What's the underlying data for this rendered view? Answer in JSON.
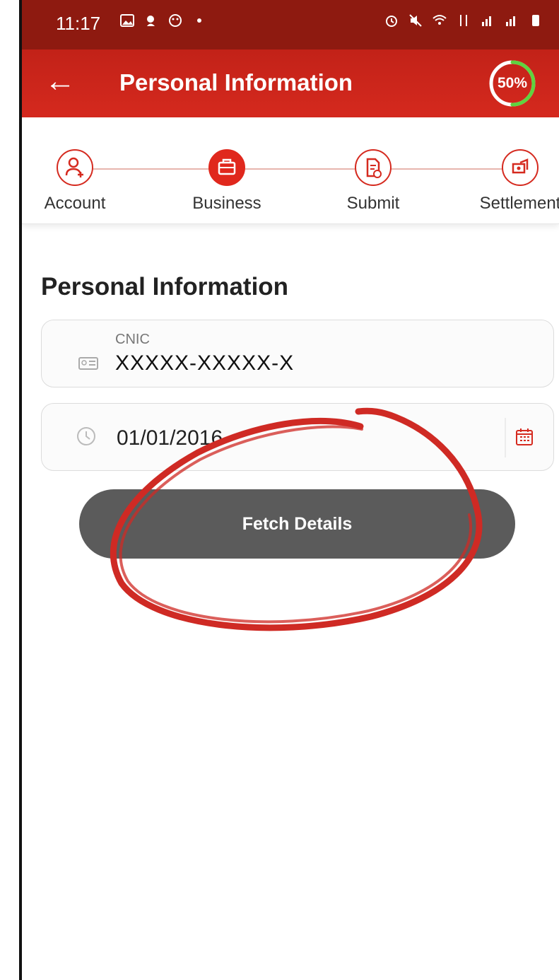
{
  "status_bar": {
    "time": "11:17"
  },
  "app_bar": {
    "title": "Personal Information",
    "back_icon": "arrow-left-icon",
    "progress_text": "50%",
    "progress": 0.5
  },
  "steps": [
    {
      "label": "Account",
      "icon": "user-add-icon"
    },
    {
      "label": "Business",
      "icon": "briefcase-icon",
      "active": true
    },
    {
      "label": "Submit",
      "icon": "document-icon"
    },
    {
      "label": "Settlement",
      "icon": "settlement-icon"
    }
  ],
  "form": {
    "section_title": "Personal Information",
    "cnic_label": "CNIC",
    "cnic_value": "XXXXX-XXXXX-X",
    "date_value": "01/01/2016",
    "fetch_label": "Fetch Details"
  },
  "colors": {
    "primary": "#d5291e",
    "status_bar": "#8e1a10",
    "button": "#5b5b5b",
    "progress_ring": "#5fd33f"
  }
}
